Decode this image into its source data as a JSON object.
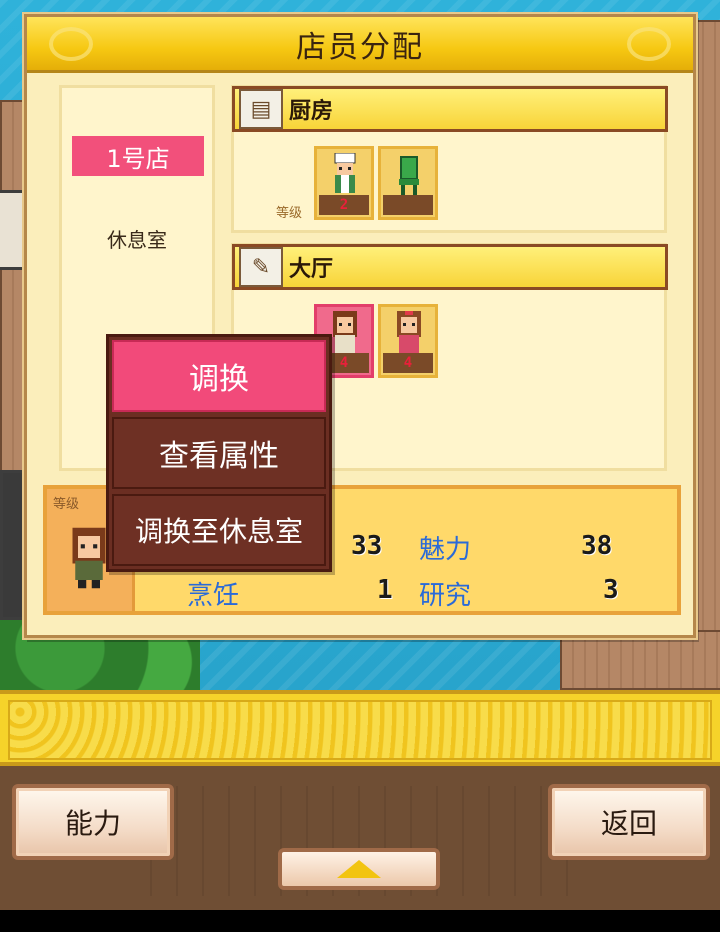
{
  "panel": {
    "title": "店员分配"
  },
  "left": {
    "shop_tag": "1号店",
    "rest_room": "休息室"
  },
  "kitchen": {
    "name": "厨房",
    "icon": "stove-icon",
    "level_tag": "等级",
    "slots": [
      {
        "name": "chef",
        "level": "2"
      },
      {
        "name": "empty-chair",
        "level": ""
      }
    ]
  },
  "hall": {
    "name": "大厅",
    "icon": "menu-icon",
    "slots": [
      {
        "name": "waitress-selected",
        "level": "4",
        "selected": true
      },
      {
        "name": "waitress",
        "level": "4",
        "selected": false
      }
    ]
  },
  "info": {
    "level_tag": "等级",
    "stats": [
      {
        "label": "",
        "value": "33"
      },
      {
        "label": "魅力",
        "value": "38"
      },
      {
        "label": "烹饪",
        "value": "1"
      },
      {
        "label": "研究",
        "value": "3"
      }
    ]
  },
  "menu": {
    "items": [
      {
        "label": "调换",
        "active": true
      },
      {
        "label": "查看属性",
        "active": false
      },
      {
        "label": "调换至休息室",
        "active": false
      }
    ]
  },
  "bottom": {
    "ability_label": "能力",
    "back_label": "返回"
  },
  "colors": {
    "accent_pink": "#f24a7a",
    "header_gold": "#f6c812",
    "stat_blue": "#2a6ad8",
    "menu_brown": "#6e3024"
  }
}
